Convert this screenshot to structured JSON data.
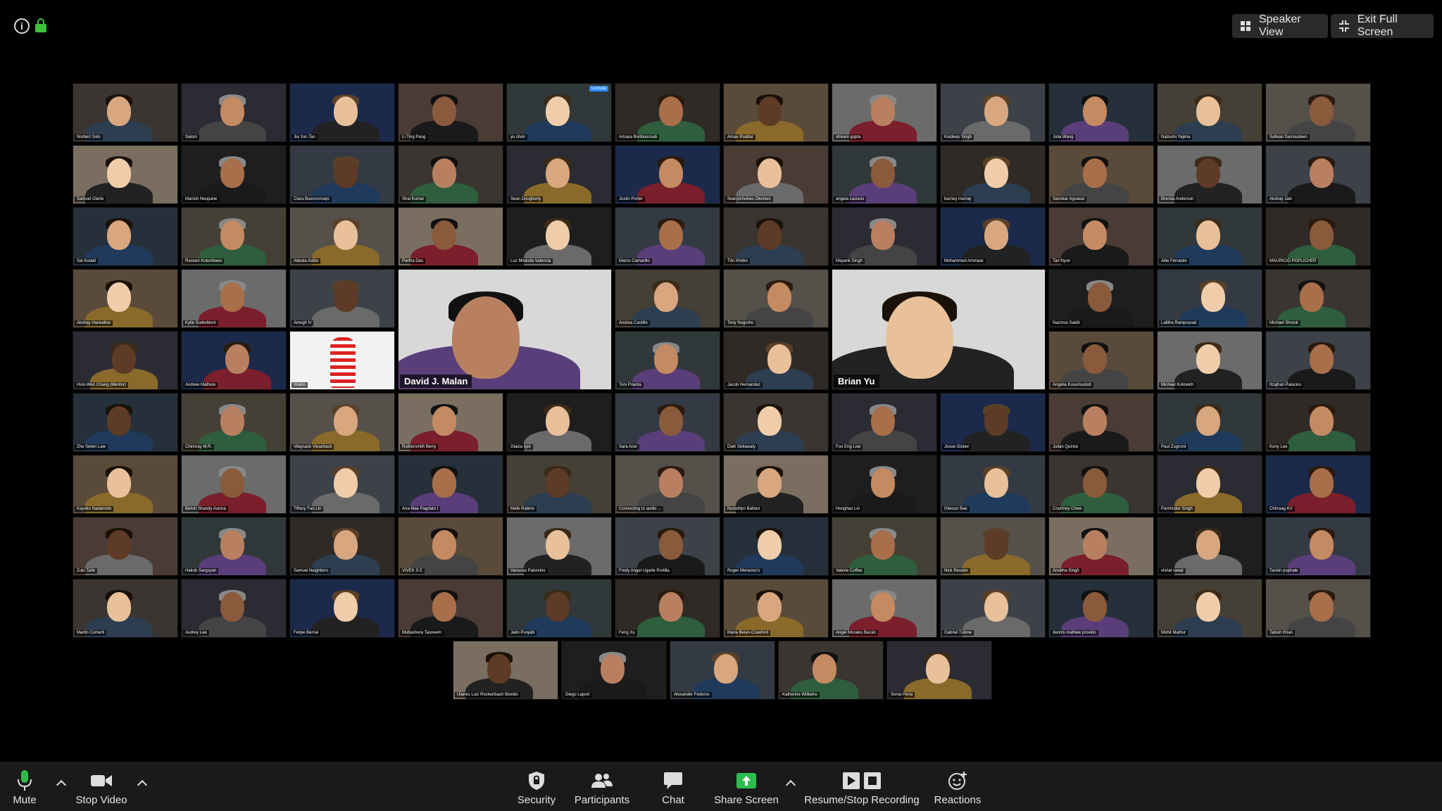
{
  "topbar": {
    "speaker_view_label": "Speaker View",
    "exit_full_screen_label": "Exit Full Screen"
  },
  "toolbar": {
    "mute_label": "Mute",
    "stop_video_label": "Stop Video",
    "security_label": "Security",
    "participants_label": "Participants",
    "chat_label": "Chat",
    "share_screen_label": "Share Screen",
    "recording_label": "Resume/Stop Recording",
    "reactions_label": "Reactions"
  },
  "participants": [
    [
      "Norbert Solo",
      "Saloni",
      "Jia Yun Tan",
      "Li Ting Pang",
      "yu chen",
      "Arisara Boriboonsub",
      "Arnav Poddar",
      "shivani gupta",
      "Kuldeep Singh",
      "Julia Wang",
      "Natsumi Yajima",
      "Safwan Samsudeen"
    ],
    [
      "Samuel Olarte",
      "Manish Neupane",
      "Clara Buenconsejo",
      "Shai Kumar",
      "Sean Dougherty",
      "Justin Porter",
      "Ifeanyichukwu Okonwo",
      "angela casiano",
      "barney murray",
      "Sanskar Agrawal",
      "Brenda Anderson",
      "Akshay Jain"
    ],
    [
      "Sai Kodali",
      "Rustam Kolumbaev",
      "Adeola Azibo",
      "Partha Das",
      "Luz Miranda Valencia",
      "Marco Camarillo",
      "Tôn Khiêm",
      "Mayank Singh",
      "Mohammed Ammaar",
      "Tan Nyon",
      "Allie Ferraiolo",
      "MAURICIO POPLICHER"
    ],
    [
      "Akshay Harwalkar",
      "Kylie Soderblom",
      "Amogh N",
      "David J. Malan",
      "",
      "Andrea Castillo",
      "Tony Nugroho",
      "Brian Yu",
      "",
      "Nazmus Sakib",
      "Lalitha Ramprasad",
      "Michael Shrock"
    ],
    [
      "Hsin-Wen Chang (Mentor)",
      "Andrew Mathew",
      "Waldo",
      "",
      "",
      "Toni Prianta",
      "Jacob Hernandez",
      "",
      "",
      "Angelia Kusumastuti",
      "Michael Kolowich",
      "Itzajhan Palacios"
    ],
    [
      "Zhe Swien Law",
      "Chinmay M.R.",
      "Vilaysack Vieachack",
      "Ruthersmith Berry",
      "Glaiza Igot",
      "Sara Aow",
      "Diah Setiawaty",
      "Foo Eng Low",
      "Josue Gisber",
      "Julian Quinze",
      "Paul Zugnoni",
      "Kony Lee"
    ],
    [
      "Kayoko Nadamoto",
      "Belvin Shandy Aurora",
      "Tiffany Fan Lin",
      "Ana Mae Pagdato I",
      "Mafé Rabino",
      "Connecting to audio ...",
      "Nureddyn Ballout",
      "Honghao Lin",
      "Giwoun Bae",
      "Courtney Chew",
      "Parminder Singh",
      "Chirraag KV"
    ],
    [
      "Zubi Tahir",
      "Hakob Sargsyan",
      "Samuel Neighbors",
      "VIVEK S E",
      "Vanessa Palomino",
      "Fredy Angel Ugarte Portilla",
      "Roger Menezes's",
      "Valerie Coffee",
      "Nick Ressler",
      "Anubha Singh",
      "vishal rawat",
      "Tanish pophale"
    ],
    [
      "Martin Comerti",
      "Audrey Lee",
      "Felipe Bernal",
      "Mubashera Tasneem",
      "Jatin Punjabi",
      "Feng Xu",
      "Maria Belan-Crawford",
      "Angel Morales Bazán",
      "Gabriel Tulone",
      "dennis mathew provido",
      "Mohit Mathur",
      "Tabish Khan"
    ],
    [
      "Ulanes Luiz Rockenbach Biondo",
      "Diego Laport",
      "Alexander Fedorov",
      "Katherine Williams",
      "Sonia Pena"
    ]
  ],
  "unmute_badge": "Unmute",
  "colors": {
    "toolbar_bg": "#1a1a1a",
    "share_green": "#2dbd4e",
    "lock_green": "#3fbf3f",
    "badge_blue": "#2d8cff"
  }
}
